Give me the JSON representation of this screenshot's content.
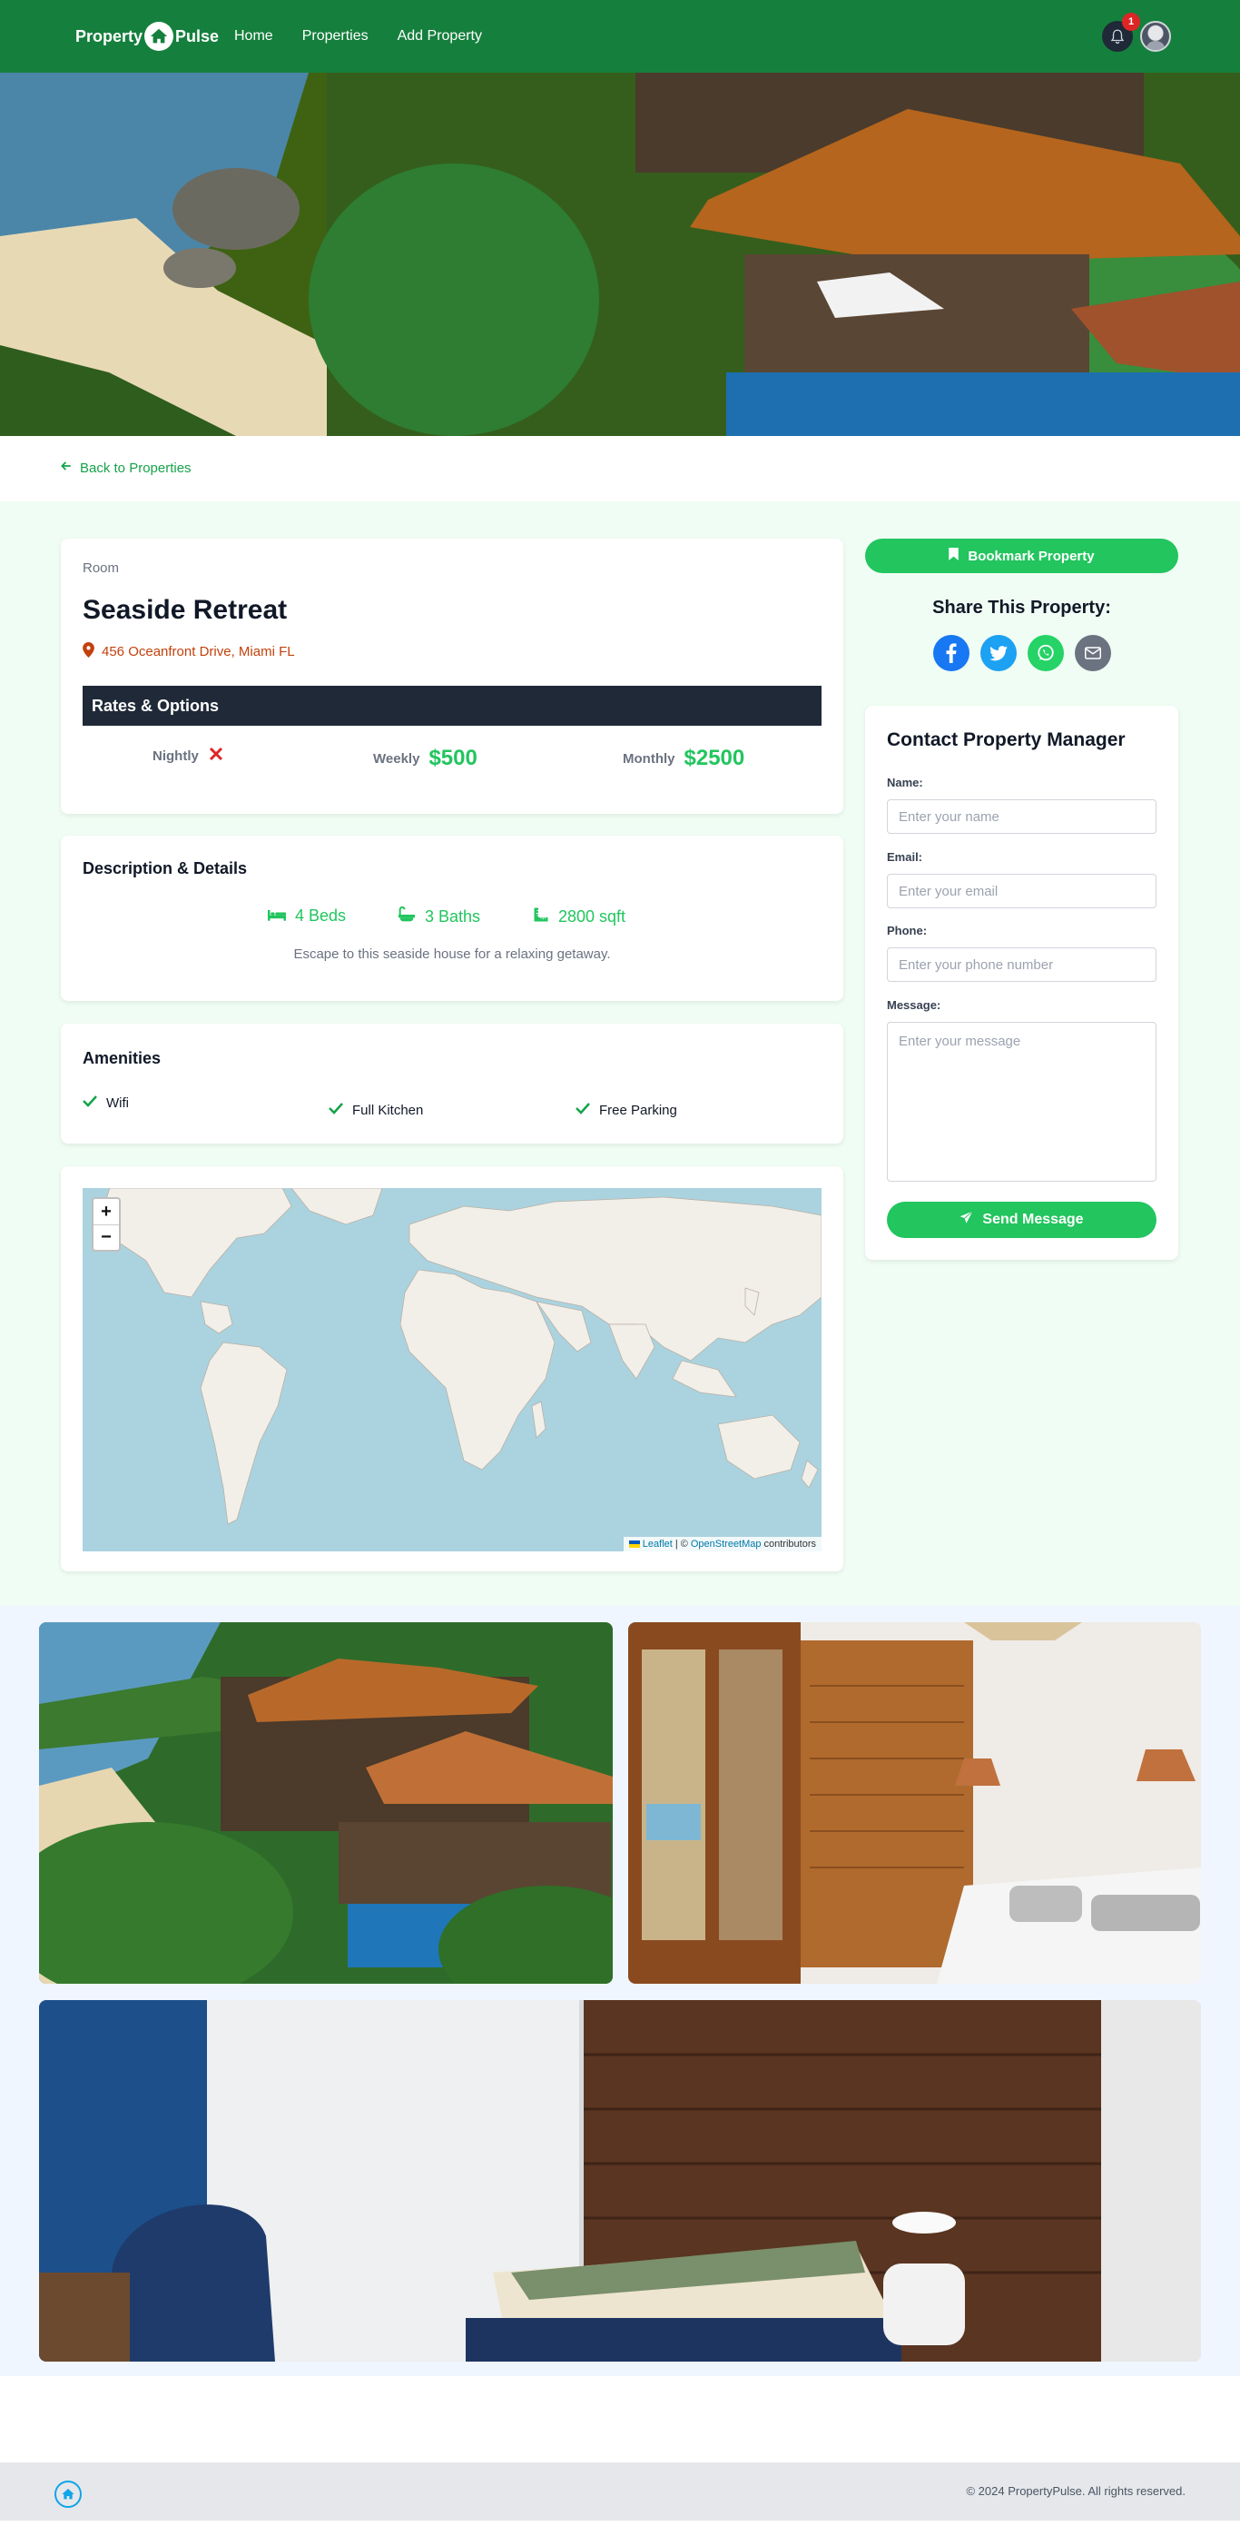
{
  "nav": {
    "brand_left": "Property",
    "brand_right": "Pulse",
    "links": [
      "Home",
      "Properties",
      "Add Property"
    ],
    "notification_count": "1"
  },
  "back_link": "Back to Properties",
  "property": {
    "type": "Room",
    "name": "Seaside Retreat",
    "address": "456 Oceanfront Drive, Miami FL",
    "rates_heading": "Rates & Options",
    "rates": [
      {
        "label": "Nightly",
        "value": null
      },
      {
        "label": "Weekly",
        "value": "$500"
      },
      {
        "label": "Monthly",
        "value": "$2500"
      }
    ],
    "details_heading": "Description & Details",
    "beds": "4 Beds",
    "baths": "3 Baths",
    "sqft": "2800 sqft",
    "description": "Escape to this seaside house for a relaxing getaway.",
    "amenities_heading": "Amenities",
    "amenities": [
      "Wifi",
      "Full Kitchen",
      "Free Parking"
    ]
  },
  "map": {
    "zoom_in": "+",
    "zoom_out": "−",
    "attribution": {
      "leaflet": "Leaflet",
      "sep": "| ©",
      "osm": "OpenStreetMap",
      "contrib": "contributors"
    }
  },
  "sidebar": {
    "bookmark_label": "Bookmark Property",
    "share_title": "Share This Property:",
    "share_icons": [
      "facebook-icon",
      "twitter-icon",
      "whatsapp-icon",
      "email-icon"
    ],
    "contact": {
      "title": "Contact Property Manager",
      "name_label": "Name:",
      "name_placeholder": "Enter your name",
      "email_label": "Email:",
      "email_placeholder": "Enter your email",
      "phone_label": "Phone:",
      "phone_placeholder": "Enter your phone number",
      "message_label": "Message:",
      "message_placeholder": "Enter your message",
      "send_label": "Send Message"
    }
  },
  "footer": {
    "copyright": "© 2024 PropertyPulse. All rights reserved."
  },
  "colors": {
    "nav": "#15803d",
    "accent": "#22c55e",
    "dark": "#1f2937",
    "address": "#c2410c",
    "section_bg": "#f0fdf4"
  }
}
